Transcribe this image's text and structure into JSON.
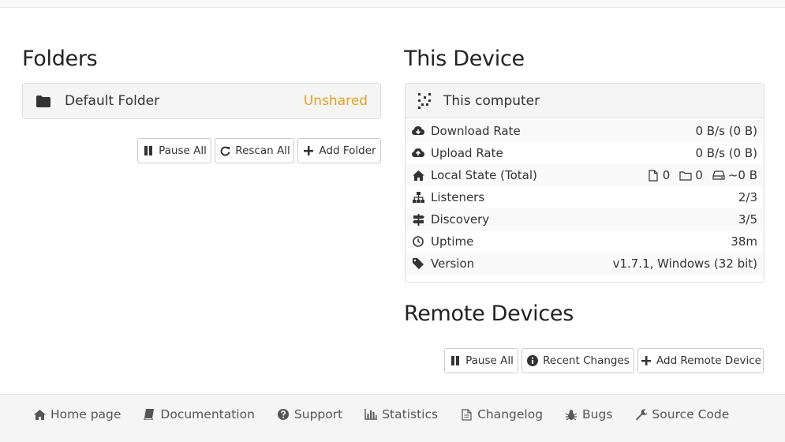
{
  "folders": {
    "title": "Folders",
    "items": [
      {
        "name": "Default Folder",
        "status": "Unshared"
      }
    ],
    "buttons": {
      "pause_all": "Pause All",
      "rescan_all": "Rescan All",
      "add_folder": "Add Folder"
    }
  },
  "this_device": {
    "title": "This Device",
    "name": "This computer",
    "rows": [
      {
        "label": "Download Rate",
        "value": "0 B/s (0 B)"
      },
      {
        "label": "Upload Rate",
        "value": "0 B/s (0 B)"
      },
      {
        "label": "Local State (Total)",
        "files": "0",
        "dirs": "0",
        "size": "~0 B"
      },
      {
        "label": "Listeners",
        "value": "2/3"
      },
      {
        "label": "Discovery",
        "value": "3/5"
      },
      {
        "label": "Uptime",
        "value": "38m"
      },
      {
        "label": "Version",
        "value": "v1.7.1, Windows (32 bit)"
      }
    ]
  },
  "remote_devices": {
    "title": "Remote Devices",
    "buttons": {
      "pause_all": "Pause All",
      "recent_changes": "Recent Changes",
      "add_remote": "Add Remote Device"
    }
  },
  "footer": {
    "links": [
      "Home page",
      "Documentation",
      "Support",
      "Statistics",
      "Changelog",
      "Bugs",
      "Source Code"
    ]
  },
  "colors": {
    "unshared": "#e4a125",
    "text": "#333333",
    "panel_head": "#f5f5f5"
  }
}
